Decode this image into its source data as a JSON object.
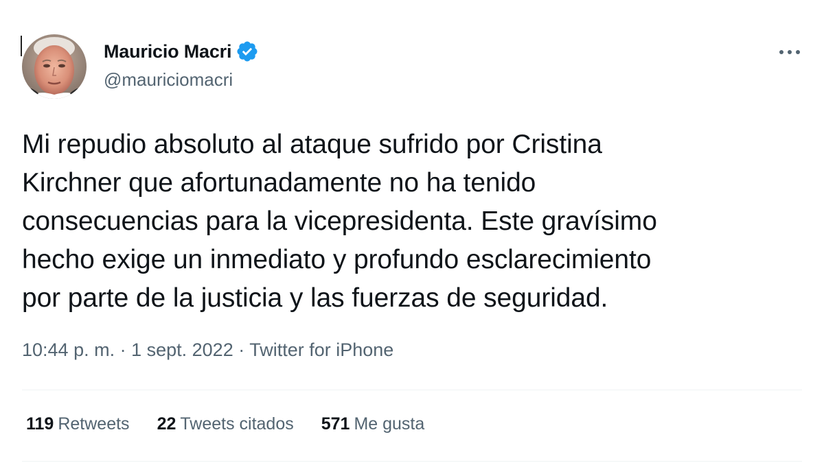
{
  "author": {
    "display_name": "Mauricio Macri",
    "handle": "@mauriciomacri",
    "verified": true,
    "avatar_icon": "profile-photo",
    "verified_icon": "verified-badge-icon",
    "verified_color": "#1d9bf0"
  },
  "menu_icon": "more-options-icon",
  "tweet": {
    "text_lines": [
      "Mi repudio absoluto al ataque sufrido por Cristina",
      "Kirchner que afortunadamente no ha tenido",
      "consecuencias para la vicepresidenta. Este gravísimo",
      "hecho exige un inmediato y profundo esclarecimiento",
      "por parte de la justicia y las fuerzas de seguridad."
    ]
  },
  "meta": {
    "time": "10:44 p. m.",
    "separator": " · ",
    "date": "1 sept. 2022",
    "source": "Twitter for iPhone"
  },
  "stats": {
    "retweets_count": "119",
    "retweets_label": "Retweets",
    "quotes_count": "22",
    "quotes_label": "Tweets citados",
    "likes_count": "571",
    "likes_label": "Me gusta"
  },
  "colors": {
    "text_primary": "#0f1419",
    "text_secondary": "#536471",
    "divider": "#eff3f4",
    "accent": "#1d9bf0"
  }
}
